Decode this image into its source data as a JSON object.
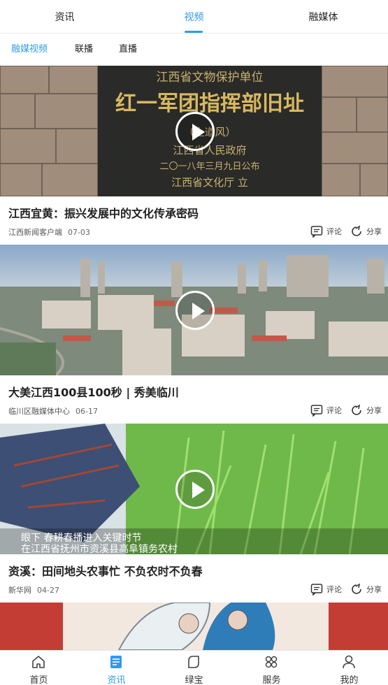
{
  "top_tabs": [
    {
      "label": "资讯",
      "active": false
    },
    {
      "label": "视频",
      "active": true
    },
    {
      "label": "融媒体",
      "active": false
    }
  ],
  "sub_tabs": [
    {
      "label": "融媒视频",
      "active": true
    },
    {
      "label": "联播",
      "active": false
    },
    {
      "label": "直播",
      "active": false
    }
  ],
  "videos": [
    {
      "title": "江西宜黄：振兴发展中的文化传承密码",
      "source": "江西新闻客户端",
      "date": "07-03",
      "comment_label": "评论",
      "share_label": "分享",
      "plaque_lines": [
        "江西省文物保护单位",
        "红一军团指挥部旧址",
        "（上遒风）",
        "江西省人民政府",
        "二〇一八年三月九日公布",
        "江西省文化厅 立"
      ]
    },
    {
      "title": "大美江西100县100秒 | 秀美临川",
      "source": "临川区融媒体中心",
      "date": "06-17",
      "comment_label": "评论",
      "share_label": "分享"
    },
    {
      "title": "资溪：田间地头农事忙 不负农时不负春",
      "source": "新华网",
      "date": "04-27",
      "comment_label": "评论",
      "share_label": "分享",
      "captions": [
        "眼下 春耕春播进入关键时节",
        "在江西省抚州市资溪县高阜镇务农村"
      ]
    },
    {
      "title": "",
      "source": "",
      "date": ""
    }
  ],
  "bottom_nav": [
    {
      "label": "首页",
      "icon": "home-icon",
      "active": false
    },
    {
      "label": "资讯",
      "icon": "news-icon",
      "active": true
    },
    {
      "label": "绿宝",
      "icon": "leaf-card-icon",
      "active": false
    },
    {
      "label": "服务",
      "icon": "grid-services-icon",
      "active": false
    },
    {
      "label": "我的",
      "icon": "user-icon",
      "active": false
    }
  ],
  "colors": {
    "accent": "#2e9bf0",
    "text": "#222222",
    "meta": "#555555"
  }
}
